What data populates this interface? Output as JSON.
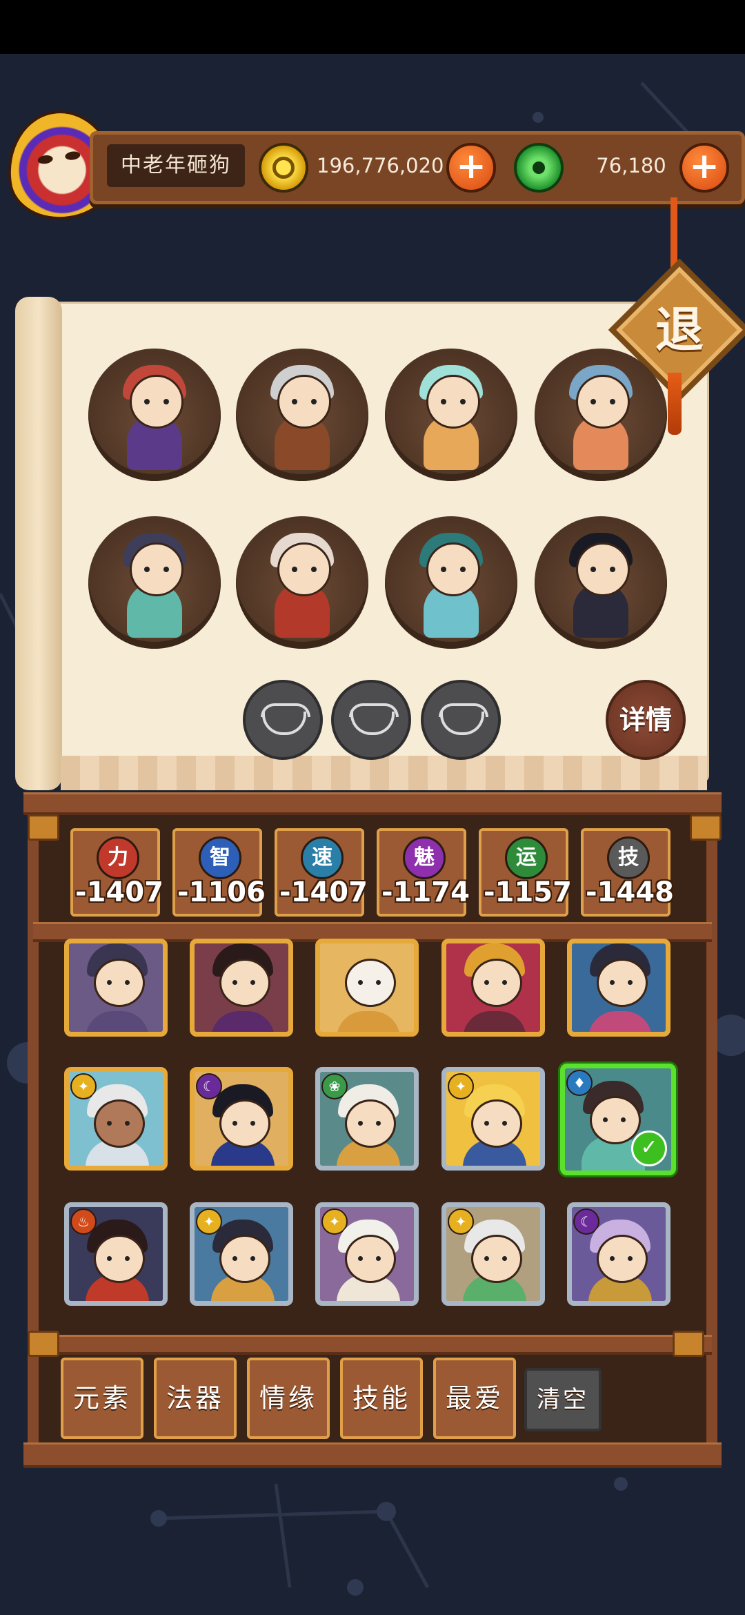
{
  "player": {
    "name": "中老年砸狗",
    "gold": "196,776,020",
    "jade": "76,180"
  },
  "icons": {
    "gold": "gold-coin-icon",
    "jade": "jade-coin-icon",
    "plus": "plus-icon",
    "bowl": "rice-bowl-icon",
    "check": "check-icon"
  },
  "exit_label": "退",
  "detail_label": "详情",
  "stats": [
    {
      "symbol": "力",
      "value": "-1407",
      "color": "#c0392b"
    },
    {
      "symbol": "智",
      "value": "-1106",
      "color": "#2e5fb8"
    },
    {
      "symbol": "速",
      "value": "-1407",
      "color": "#2a7fa8"
    },
    {
      "symbol": "魅",
      "value": "-1174",
      "color": "#8e2fae"
    },
    {
      "symbol": "运",
      "value": "-1157",
      "color": "#2e8b3a"
    },
    {
      "symbol": "技",
      "value": "-1448",
      "color": "#5a5a5a"
    }
  ],
  "tabs": [
    "元素",
    "法器",
    "情缘",
    "技能",
    "最爱",
    "清空"
  ],
  "colors": {
    "accent_orange": "#d84a12",
    "wood": "#84492a",
    "parchment": "#f7ecd6",
    "selected_green": "#5be02d"
  }
}
